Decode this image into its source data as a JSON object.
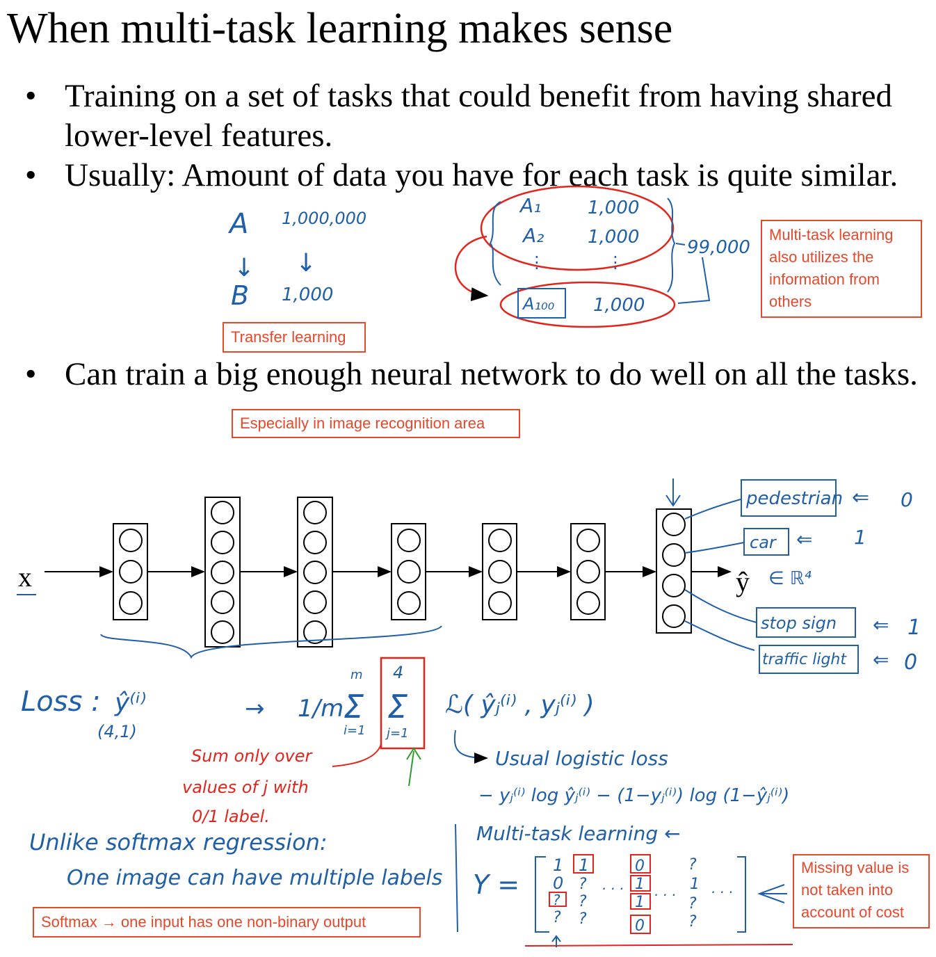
{
  "slide": {
    "title": "When multi-task learning makes sense",
    "bullets": [
      {
        "marker": "•",
        "text": "Training on a set of tasks that could benefit from having shared lower-level features."
      },
      {
        "marker": "•",
        "text": "Usually: Amount of data you have for each task is quite similar."
      },
      {
        "marker": "•",
        "text": "Can train a big enough neural network to do well on all the tasks."
      }
    ]
  },
  "notes": {
    "transfer": "Transfer learning",
    "multitask": "Multi-task learning also utilizes the information from others",
    "image_recognition": "Especially in image recognition area",
    "softmax": "Softmax → one input has one non-binary output",
    "missing": "Missing value is not taken into account of cost"
  },
  "annotations": {
    "transfer": {
      "a": "A",
      "a_count": "1,000,000",
      "b": "B",
      "b_count": "1,000",
      "arrow": "↓"
    },
    "multitask": {
      "a1": "A₁",
      "a1_count": "1,000",
      "a2": "A₂",
      "a2_count": "1,000",
      "a100": "A₁₀₀",
      "a100_count": "1,000",
      "total": "99,000"
    },
    "network": {
      "input": "x",
      "output": "ŷ",
      "output_space": "∈ ℝ⁴"
    },
    "labels": [
      {
        "name": "pedestrian",
        "value": "0"
      },
      {
        "name": "car",
        "value": "1"
      },
      {
        "name": "stop sign",
        "value": "1"
      },
      {
        "name": "traffic light",
        "value": "0"
      }
    ],
    "loss": {
      "label": "Loss :",
      "yhat": "ŷ⁽ⁱ⁾",
      "shape": "(4,1)",
      "formula_arrow": "→",
      "frac": "1/m",
      "sum_m": "Σ",
      "sum_m_top": "m",
      "sum_m_bottom": "i=1",
      "sum_j_top": "4",
      "sum_j_bottom": "j=1",
      "term": "ℒ( ŷⱼ⁽ⁱ⁾ , yⱼ⁽ⁱ⁾ )",
      "usual": "Usual logistic loss",
      "logistic": "− yⱼ⁽ⁱ⁾ log ŷⱼ⁽ⁱ⁾ − (1−yⱼ⁽ⁱ⁾) log (1−ŷⱼ⁽ⁱ⁾)",
      "sum_note": [
        "Sum only over",
        "values of j with",
        "0/1 label."
      ]
    },
    "softmax_note": [
      "Unlike softmax regression:",
      "One image can have multiple labels"
    ],
    "matrix": {
      "title": "Multi-task learning ←",
      "y": "Y =",
      "columns": [
        [
          "1",
          "0",
          "?",
          "?"
        ],
        [
          "1",
          "?",
          "?",
          "?"
        ],
        [
          "0",
          "1",
          "1",
          "0"
        ],
        [
          "?",
          "1",
          "?",
          "?"
        ]
      ],
      "dots": "· · ·"
    }
  },
  "colors": {
    "blue_ink": "#1f5fa8",
    "red_ink": "#e3241b",
    "note_orange": "#e8472a",
    "green_ink": "#2a9d2a"
  }
}
